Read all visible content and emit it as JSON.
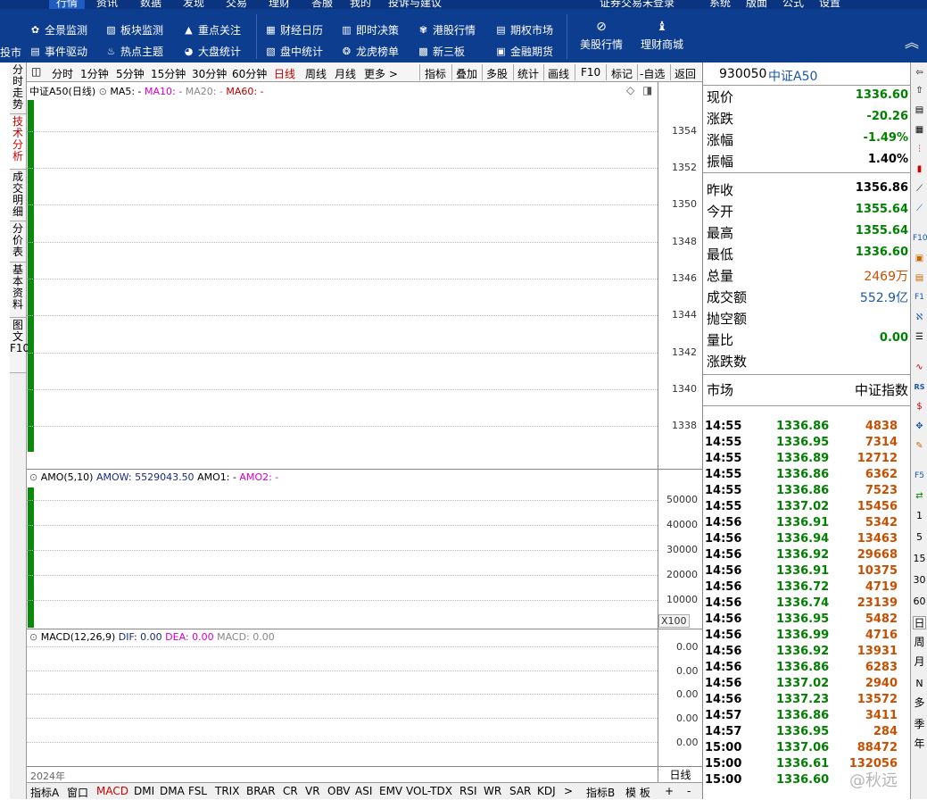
{
  "top_menu": [
    "行情",
    "资讯",
    "数据",
    "发现",
    "交易",
    "理财",
    "答服",
    "我的",
    "投诉与建议",
    "证券交易未登录",
    "系统",
    "版面",
    "公式",
    "设置"
  ],
  "toolbar": {
    "left_edge": "投市",
    "row1": [
      "全景监测",
      "板块监测",
      "重点关注",
      "财经日历",
      "即时决策",
      "港股行情",
      "期权市场"
    ],
    "row2": [
      "事件驱动",
      "热点主题",
      "大盘统计",
      "盘中统计",
      "龙虎榜单",
      "新三板",
      "金融期货"
    ],
    "us_stocks": "美股行情",
    "wealth_mall": "理财商城"
  },
  "left_tabs": [
    "分时走势",
    "技术分析",
    "成交明细",
    "分价表",
    "基本资料",
    "图文F10"
  ],
  "chart_toolbar": {
    "periods": [
      "分时",
      "1分钟",
      "5分钟",
      "15分钟",
      "30分钟",
      "60分钟",
      "日线",
      "周线",
      "月线",
      "更多 >"
    ],
    "actions": [
      "指标",
      "叠加",
      "多股",
      "统计",
      "画线",
      "F10",
      "标记",
      "-自选",
      "返回"
    ]
  },
  "main_panel": {
    "title": "中证A50(日线)",
    "ma5": "MA5: -",
    "ma10": "MA10: -",
    "ma20": "MA20: -",
    "ma60": "MA60: -",
    "y_ticks": [
      "1354",
      "1352",
      "1350",
      "1348",
      "1346",
      "1344",
      "1342",
      "1340",
      "1338"
    ]
  },
  "amo_panel": {
    "title": "AMO(5,10)",
    "amow": "AMOW: 5529043.50",
    "amo1": "AMO1: -",
    "amo2": "AMO2: -",
    "y_ticks": [
      "50000",
      "40000",
      "30000",
      "20000",
      "10000"
    ],
    "unit": "X100"
  },
  "macd_panel": {
    "title": "MACD(12,26,9)",
    "dif": "DIF: 0.00",
    "dea": "DEA: 0.00",
    "macd": "MACD: 0.00",
    "y_ticks": [
      "0.00",
      "0.00",
      "0.00",
      "0.00",
      "0.00"
    ]
  },
  "x_axis_label": "2024年",
  "period_label": "日线",
  "bottom_tabs": [
    "指标A",
    "窗口",
    "MACD",
    "DMI",
    "DMA",
    "FSL",
    "TRIX",
    "BRAR",
    "CR",
    "VR",
    "OBV",
    "ASI",
    "EMV",
    "VOL-TDX",
    "RSI",
    "WR",
    "SAR",
    "KDJ",
    ">",
    "指标B",
    "模 板",
    "+",
    "-"
  ],
  "quote": {
    "code": "930050",
    "name": "中证A50",
    "rows": [
      {
        "label": "现价",
        "value": "1336.60",
        "color": "green"
      },
      {
        "label": "涨跌",
        "value": "-20.26",
        "color": "green"
      },
      {
        "label": "涨幅",
        "value": "-1.49%",
        "color": "green"
      },
      {
        "label": "振幅",
        "value": "1.40%",
        "color": "black"
      },
      {
        "label": "昨收",
        "value": "1356.86",
        "color": "black"
      },
      {
        "label": "今开",
        "value": "1355.64",
        "color": "green"
      },
      {
        "label": "最高",
        "value": "1355.64",
        "color": "green"
      },
      {
        "label": "最低",
        "value": "1336.60",
        "color": "green"
      },
      {
        "label": "总量",
        "value": "2469万",
        "color": "orange"
      },
      {
        "label": "成交额",
        "value": "552.9亿",
        "color": "blue"
      },
      {
        "label": "抛空额",
        "value": "",
        "color": "black"
      },
      {
        "label": "量比",
        "value": "0.00",
        "color": "green"
      },
      {
        "label": "涨跌数",
        "value": "",
        "color": "black"
      }
    ],
    "market_label": "市场",
    "market_value": "中证指数"
  },
  "ticks": [
    [
      "14:55",
      "1336.86",
      "4838"
    ],
    [
      "14:55",
      "1336.95",
      "7314"
    ],
    [
      "14:55",
      "1336.89",
      "12712"
    ],
    [
      "14:55",
      "1336.86",
      "6362"
    ],
    [
      "14:55",
      "1336.86",
      "7523"
    ],
    [
      "14:55",
      "1337.02",
      "15456"
    ],
    [
      "14:56",
      "1336.91",
      "5342"
    ],
    [
      "14:56",
      "1336.94",
      "13463"
    ],
    [
      "14:56",
      "1336.92",
      "29668"
    ],
    [
      "14:56",
      "1336.91",
      "10375"
    ],
    [
      "14:56",
      "1336.72",
      "4719"
    ],
    [
      "14:56",
      "1336.74",
      "23139"
    ],
    [
      "14:56",
      "1336.95",
      "5482"
    ],
    [
      "14:56",
      "1336.99",
      "4716"
    ],
    [
      "14:56",
      "1336.92",
      "13931"
    ],
    [
      "14:56",
      "1336.86",
      "6283"
    ],
    [
      "14:56",
      "1337.02",
      "2940"
    ],
    [
      "14:56",
      "1337.23",
      "13572"
    ],
    [
      "14:57",
      "1336.86",
      "3411"
    ],
    [
      "14:57",
      "1336.95",
      "284"
    ],
    [
      "15:00",
      "1337.06",
      "88472"
    ],
    [
      "15:00",
      "1336.61",
      "132056"
    ],
    [
      "15:00",
      "1336.60",
      ""
    ]
  ],
  "right_icons": [
    "1",
    "5",
    "15",
    "30",
    "60",
    "日",
    "周",
    "月",
    "N",
    "多",
    "季",
    "年"
  ],
  "watermark": "@秋远"
}
